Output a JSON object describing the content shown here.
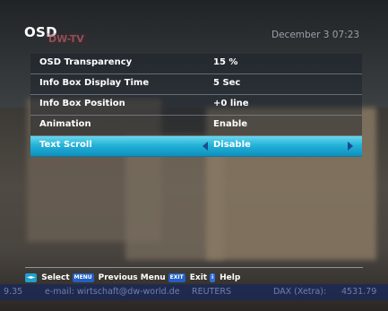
{
  "header": {
    "title": "OSD",
    "datetime": "December 3 07:23",
    "channel_logo": "DW-TV"
  },
  "menu": {
    "items": [
      {
        "label": "OSD Transparency",
        "value": "15 %"
      },
      {
        "label": "Info Box Display Time",
        "value": "5 Sec"
      },
      {
        "label": "Info Box Position",
        "value": "+0 line"
      },
      {
        "label": "Animation",
        "value": "Enable"
      },
      {
        "label": "Text Scroll",
        "value": "Disable",
        "selected": true
      }
    ]
  },
  "footer": {
    "select_key": "◄►",
    "select_label": "Select",
    "menu_key": "MENU",
    "menu_label": "Previous Menu",
    "exit_key": "EXIT",
    "exit_label": "Exit",
    "help_key": "i",
    "help_label": "Help"
  },
  "ticker": {
    "left_fragment": "9.35",
    "email": "e-mail: wirtschaft@dw-world.de",
    "source": "REUTERS",
    "index_label": "DAX (Xetra):",
    "index_value": "4531.79"
  },
  "colors": {
    "selection": "#23b3d8",
    "key_blue": "#2260c5"
  }
}
